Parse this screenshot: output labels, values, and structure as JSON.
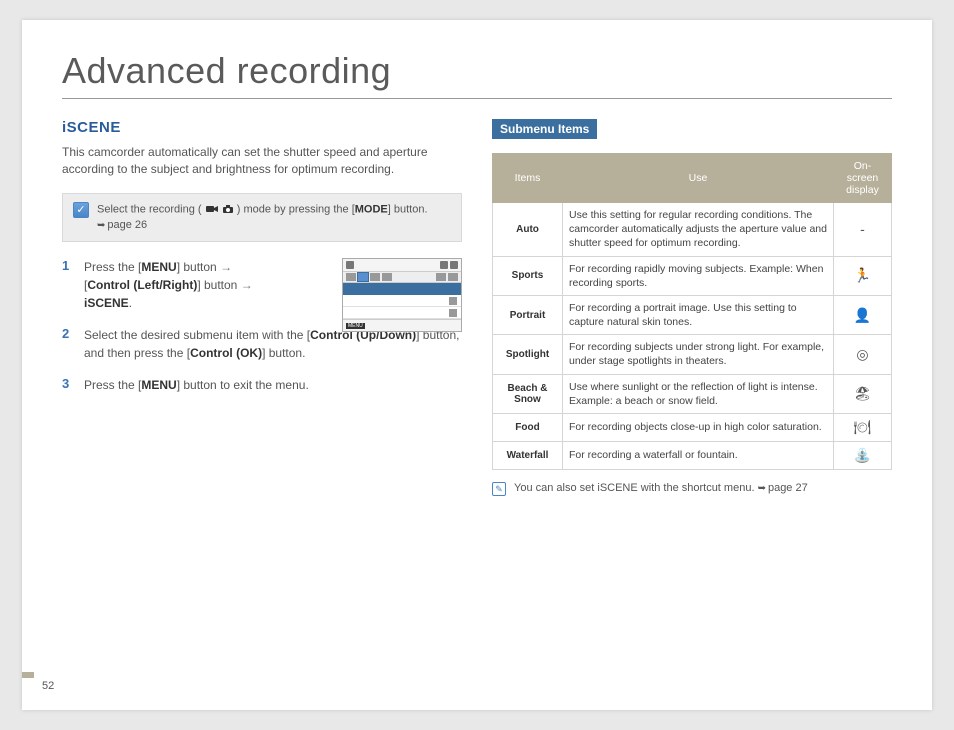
{
  "page_title": "Advanced recording",
  "page_number": "52",
  "left": {
    "section": "iSCENE",
    "intro": "This camcorder automatically can set the shutter speed and aperture according to the subject and brightness for optimum recording.",
    "callout_pre": "Select the recording ( ",
    "callout_post": " ) mode by pressing the [",
    "callout_mode": "MODE",
    "callout_tail": "] button. ",
    "callout_ref": "page 26",
    "steps": [
      {
        "n": "1",
        "parts": [
          "Press the [",
          "MENU",
          "] button ",
          "[",
          "Control (Left/Right)",
          "] button ",
          "",
          "iSCENE",
          "."
        ]
      },
      {
        "n": "2",
        "parts": [
          "Select the desired submenu item with the [",
          "Control (Up/Down)",
          "] button, and then press the [",
          "Control (OK)",
          "] button."
        ]
      },
      {
        "n": "3",
        "parts": [
          "Press the [",
          "MENU",
          "] button to exit the menu."
        ]
      }
    ],
    "mini_screen_menu_label": "MENU"
  },
  "right": {
    "submenu_label": "Submenu Items",
    "headers": [
      "Items",
      "Use",
      "On-screen display"
    ],
    "rows": [
      {
        "item": "Auto",
        "use": "Use this setting for regular recording conditions. The camcorder automatically adjusts the aperture value and shutter speed for optimum recording.",
        "disp": "-"
      },
      {
        "item": "Sports",
        "use": "For recording rapidly moving subjects. Example: When recording sports.",
        "disp": "🏃"
      },
      {
        "item": "Portrait",
        "use": "For recording a portrait image. Use this setting to capture natural skin tones.",
        "disp": "👤"
      },
      {
        "item": "Spotlight",
        "use": "For recording subjects under strong light. For example, under stage spotlights in theaters.",
        "disp": "◎"
      },
      {
        "item": "Beach & Snow",
        "use": "Use where sunlight or the reflection of light is intense. Example: a beach or snow field.",
        "disp": "🏖"
      },
      {
        "item": "Food",
        "use": "For recording objects close-up in high color saturation.",
        "disp": "🍽"
      },
      {
        "item": "Waterfall",
        "use": "For recording a waterfall or fountain.",
        "disp": "⛲"
      }
    ],
    "note": "You can also set iSCENE with the shortcut menu. ",
    "note_ref": "page 27"
  }
}
